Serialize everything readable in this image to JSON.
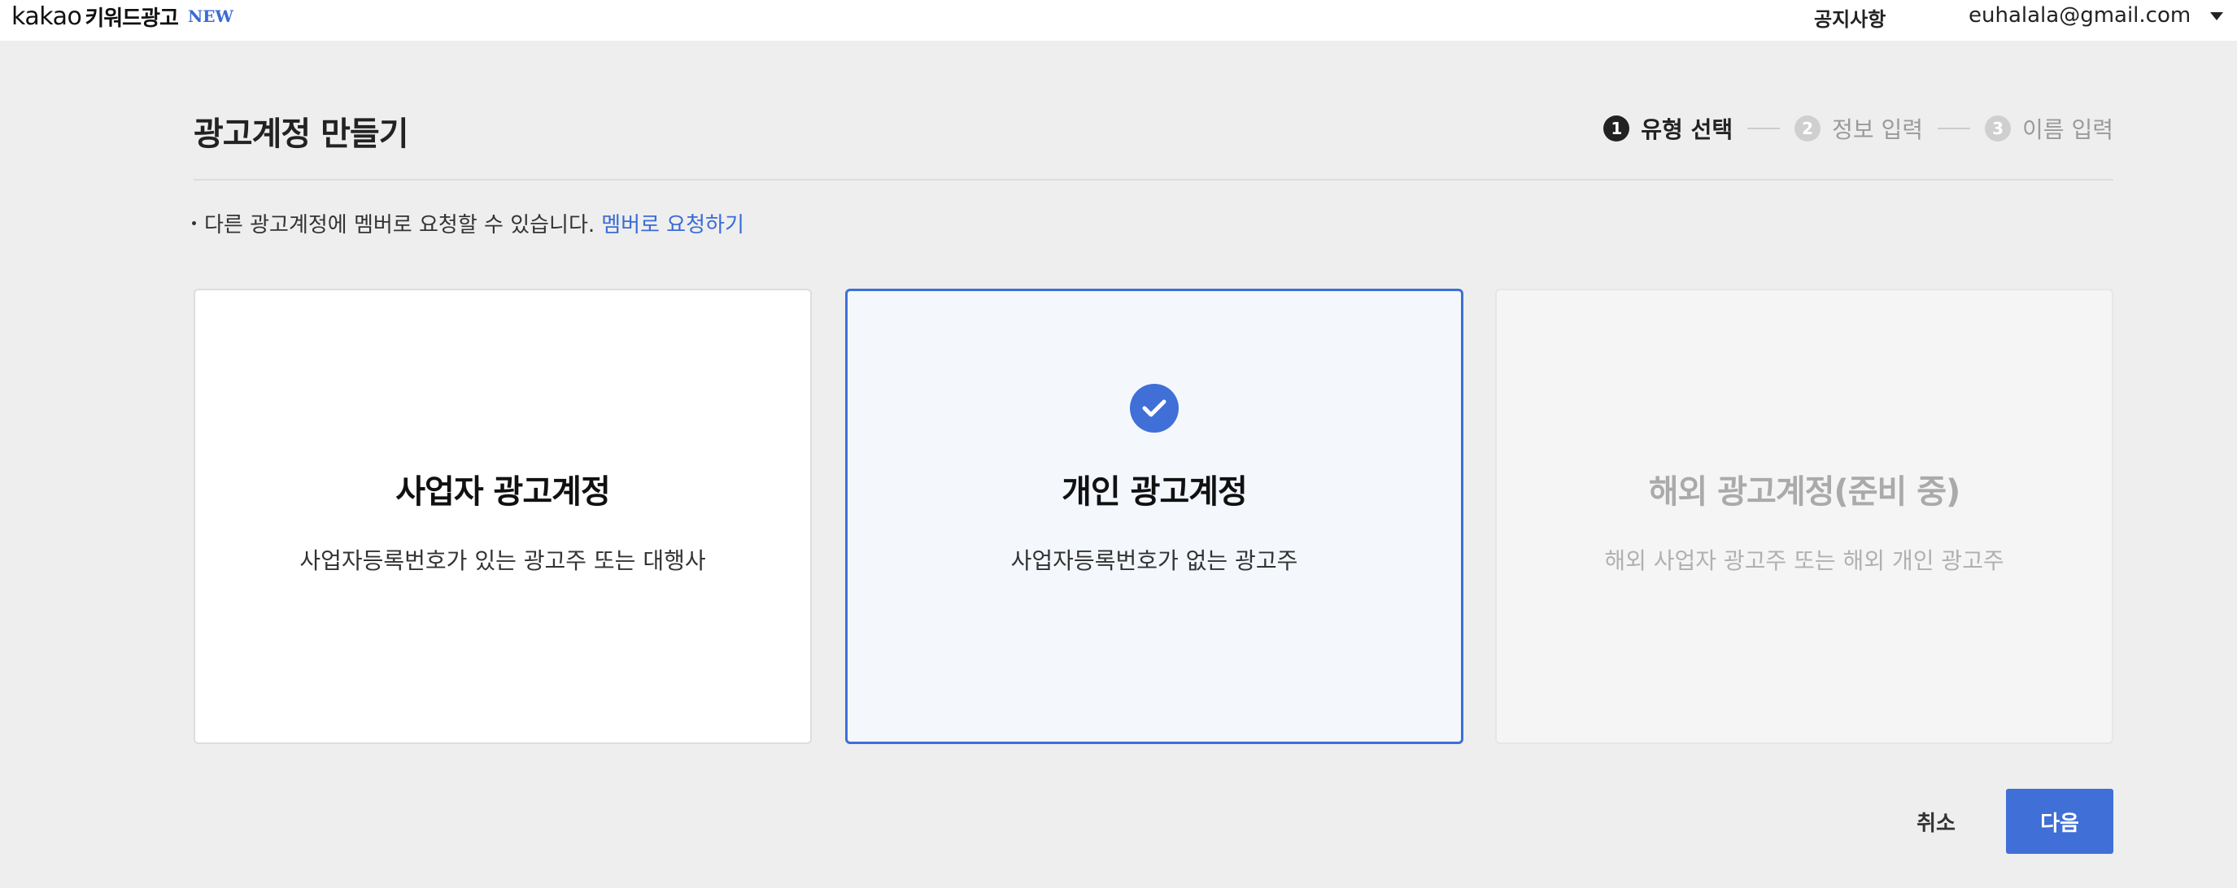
{
  "header": {
    "logo_kakao": "kakao",
    "logo_product": "키워드광고",
    "logo_badge": "NEW",
    "notice_label": "공지사항",
    "user_email": "euhalala@gmail.com"
  },
  "page": {
    "title": "광고계정 만들기",
    "info_text": "다른 광고계정에 멤버로 요청할 수 있습니다.",
    "member_link": "멤버로 요청하기"
  },
  "stepper": {
    "current_step": 1,
    "steps": [
      {
        "num": "1",
        "label": "유형 선택"
      },
      {
        "num": "2",
        "label": "정보 입력"
      },
      {
        "num": "3",
        "label": "이름 입력"
      }
    ]
  },
  "cards": [
    {
      "title": "사업자 광고계정",
      "desc": "사업자등록번호가 있는 광고주 또는 대행사",
      "selected": false,
      "disabled": false
    },
    {
      "title": "개인 광고계정",
      "desc": "사업자등록번호가 없는 광고주",
      "selected": true,
      "disabled": false
    },
    {
      "title": "해외 광고계정(준비 중)",
      "desc": "해외 사업자 광고주 또는 해외 개인 광고주",
      "selected": false,
      "disabled": true
    }
  ],
  "actions": {
    "cancel_label": "취소",
    "next_label": "다음"
  },
  "colors": {
    "accent": "#3f6fd7",
    "background": "#eeeeee"
  },
  "icons": {
    "selected_check": "check-circle-icon",
    "user_menu": "caret-down-icon"
  }
}
